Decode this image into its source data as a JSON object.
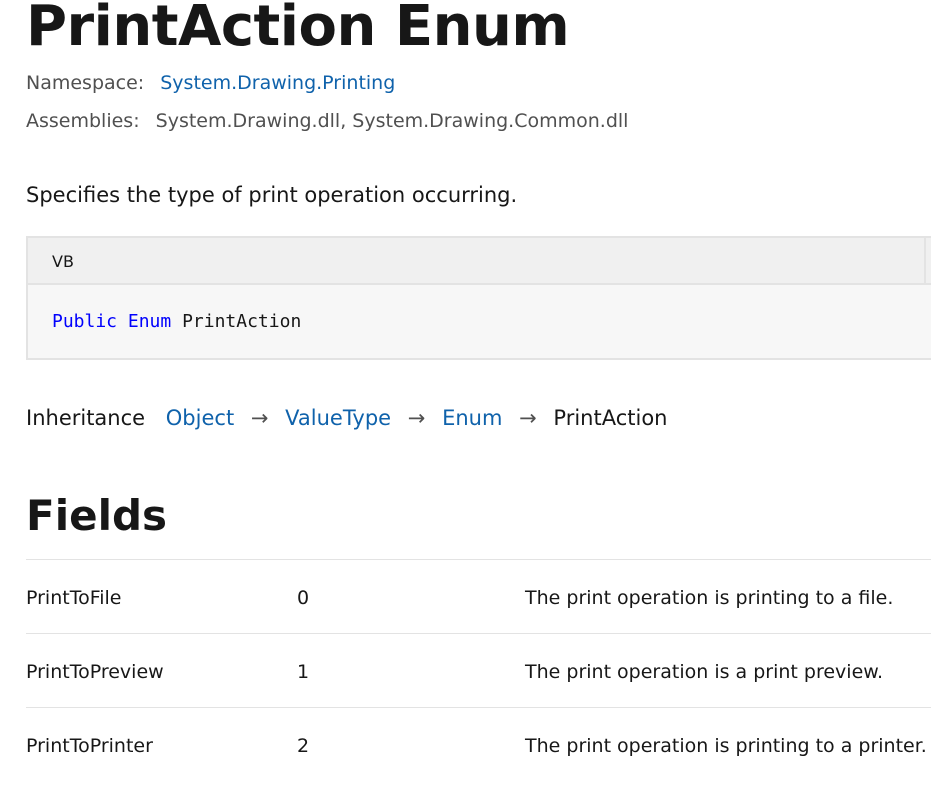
{
  "page": {
    "title": "PrintAction Enum",
    "namespace_label": "Namespace:",
    "namespace_value": "System.Drawing.Printing",
    "assemblies_label": "Assemblies:",
    "assemblies_value": "System.Drawing.dll, System.Drawing.Common.dll",
    "summary": "Specifies the type of print operation occurring."
  },
  "code": {
    "language": "VB",
    "keyword_public": "Public",
    "keyword_enum": "Enum",
    "identifier": "PrintAction"
  },
  "inheritance": {
    "label": "Inheritance",
    "chain": [
      "Object",
      "ValueType",
      "Enum"
    ],
    "current": "PrintAction",
    "arrow": "→"
  },
  "fields": {
    "heading": "Fields",
    "rows": [
      {
        "name": "PrintToFile",
        "value": "0",
        "description": "The print operation is printing to a file."
      },
      {
        "name": "PrintToPreview",
        "value": "1",
        "description": "The print operation is a print preview."
      },
      {
        "name": "PrintToPrinter",
        "value": "2",
        "description": "The print operation is printing to a printer."
      }
    ]
  },
  "colors": {
    "link": "#0f62ab",
    "keyword": "#0101fd",
    "code_background": "#f7f7f7",
    "code_header": "#f0f0f0",
    "border": "#e3e3e3"
  }
}
